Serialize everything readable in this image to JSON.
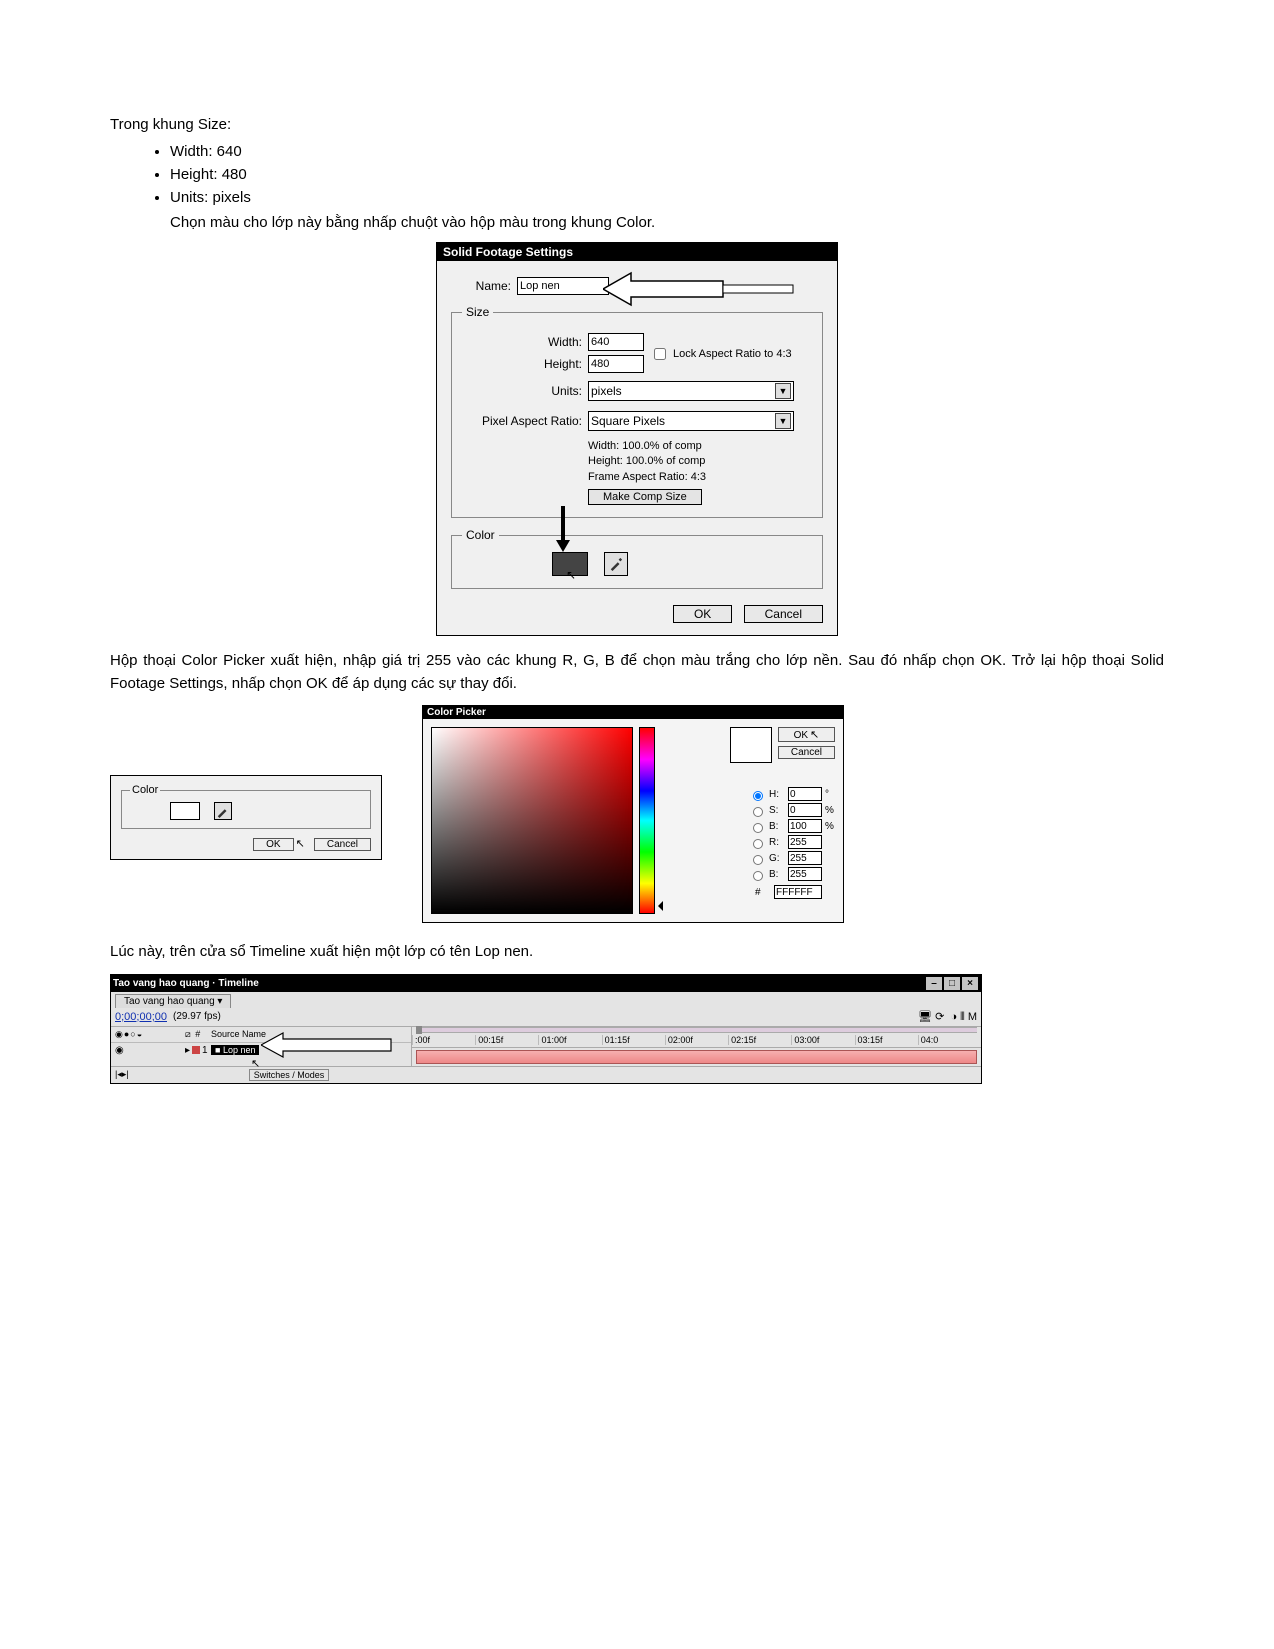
{
  "intro": "Trong khung Size:",
  "bullets": [
    "Width: 640",
    "Height: 480",
    "Units: pixels"
  ],
  "para1": "Chọn màu cho lớp này bằng nhấp chuột vào hộp màu trong khung Color.",
  "solid": {
    "title": "Solid Footage Settings",
    "name_label": "Name:",
    "name_value": "Lop nen",
    "size_legend": "Size",
    "width_label": "Width:",
    "width_value": "640",
    "height_label": "Height:",
    "height_value": "480",
    "lock_label": "Lock Aspect Ratio to 4:3",
    "units_label": "Units:",
    "units_value": "pixels",
    "par_label": "Pixel Aspect Ratio:",
    "par_value": "Square Pixels",
    "info_w": "Width:  100.0% of comp",
    "info_h": "Height:  100.0% of comp",
    "info_f": "Frame Aspect Ratio: 4:3",
    "make_comp": "Make Comp Size",
    "color_legend": "Color",
    "ok": "OK",
    "cancel": "Cancel"
  },
  "para2": "Hộp thoại Color Picker xuất hiện, nhập giá trị 255 vào các khung R, G, B để chọn màu trắng cho lớp nền. Sau đó nhấp chọn OK. Trở lại hộp thoại Solid Footage Settings, nhấp chọn OK để áp dụng các sự thay đổi.",
  "mini_color": {
    "legend": "Color",
    "ok": "OK",
    "cancel": "Cancel"
  },
  "picker": {
    "title": "Color Picker",
    "ok": "OK",
    "cancel": "Cancel",
    "h_lab": "H:",
    "h_val": "0",
    "h_unit": "°",
    "s_lab": "S:",
    "s_val": "0",
    "s_unit": "%",
    "b_lab": "B:",
    "b_val": "100",
    "b_unit": "%",
    "r_lab": "R:",
    "r_val": "255",
    "g_lab": "G:",
    "g_val": "255",
    "bb_lab": "B:",
    "bb_val": "255",
    "hex_lab": "#",
    "hex_val": "FFFFFF"
  },
  "para3": "Lúc này, trên cửa sổ Timeline xuất hiện một lớp có tên Lop nen.",
  "timeline": {
    "title": "Tao vang hao quang · Timeline",
    "tab": "Tao vang hao quang",
    "timecode": "0;00;00;00",
    "fps": "(29.97 fps)",
    "col_source": "Source Name",
    "layer_num": "1",
    "layer_name": "Lop nen",
    "ruler": [
      ":00f",
      "00:15f",
      "01:00f",
      "01:15f",
      "02:00f",
      "02:15f",
      "03:00f",
      "03:15f",
      "04:0"
    ],
    "switches": "Switches / Modes"
  }
}
